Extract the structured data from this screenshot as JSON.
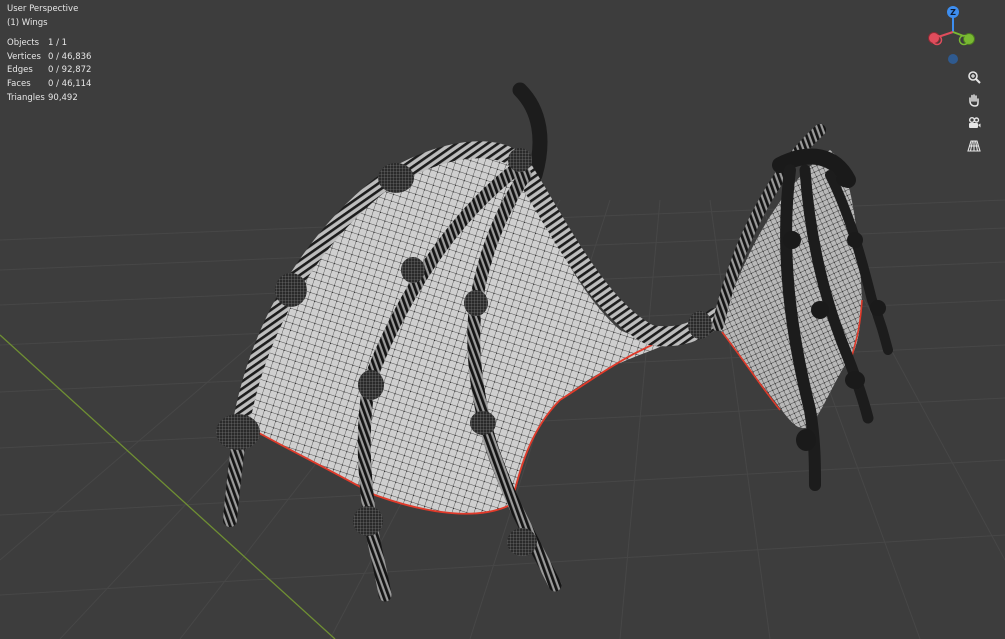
{
  "overlay": {
    "perspective": "User Perspective",
    "object_name": "(1) Wings",
    "stats": [
      {
        "label": "Objects",
        "value": "1 / 1"
      },
      {
        "label": "Vertices",
        "value": "0 / 46,836"
      },
      {
        "label": "Edges",
        "value": "0 / 92,872"
      },
      {
        "label": "Faces",
        "value": "0 / 46,114"
      },
      {
        "label": "Triangles",
        "value": "90,492"
      }
    ]
  },
  "gizmo": {
    "z_label": "Z",
    "colors": {
      "x": "#e04d5c",
      "y": "#79b932",
      "z": "#3d8ef0"
    }
  },
  "nav_buttons": [
    {
      "icon": "zoom-icon"
    },
    {
      "icon": "hand-pan-icon"
    },
    {
      "icon": "camera-icon"
    },
    {
      "icon": "grid-perspective-icon"
    }
  ],
  "colors": {
    "background": "#3d3d3d",
    "grid": "#474747",
    "x_axis": "#7a9a3a",
    "wing_membrane": "#d2d2d2",
    "wire": "#1a1a1a",
    "boundary": "#e03a2a"
  }
}
